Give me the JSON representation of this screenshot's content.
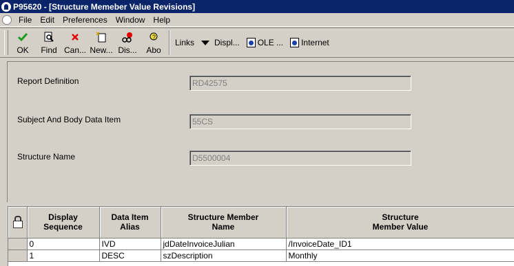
{
  "window": {
    "title": "P95620 - [Structure Memeber Value Revisions]"
  },
  "menu": [
    "File",
    "Edit",
    "Preferences",
    "Window",
    "Help"
  ],
  "toolbar": {
    "buttons": [
      {
        "label": "OK",
        "icon": "check-icon"
      },
      {
        "label": "Find",
        "icon": "find-icon"
      },
      {
        "label": "Can...",
        "icon": "cancel-icon"
      },
      {
        "label": "New...",
        "icon": "new-icon"
      },
      {
        "label": "Dis...",
        "icon": "display-icon"
      },
      {
        "label": "Abo",
        "icon": "about-icon"
      }
    ],
    "links_label": "Links",
    "display_label": "Displ...",
    "ole_label": "OLE ...",
    "internet_label": "Internet"
  },
  "form": {
    "report_definition": {
      "label": "Report Definition",
      "value": "RD42575"
    },
    "subject_body": {
      "label": "Subject And Body Data Item",
      "value": "55CS"
    },
    "structure_name": {
      "label": "Structure Name",
      "value": "D5500004"
    }
  },
  "grid": {
    "columns": [
      {
        "line1": "Display",
        "line2": "Sequence"
      },
      {
        "line1": "Data Item",
        "line2": "Alias"
      },
      {
        "line1": "Structure Member",
        "line2": "Name"
      },
      {
        "line1": "Structure",
        "line2": "Member Value"
      }
    ],
    "rows": [
      {
        "seq": "0",
        "alias": "IVD",
        "name": "jdDateInvoiceJulian",
        "value": "/InvoiceDate_ID1"
      },
      {
        "seq": "1",
        "alias": "DESC",
        "name": "szDescription",
        "value": "Monthly"
      }
    ]
  },
  "colors": {
    "titlebar": "#0a246a",
    "chrome": "#d4d0c8"
  }
}
